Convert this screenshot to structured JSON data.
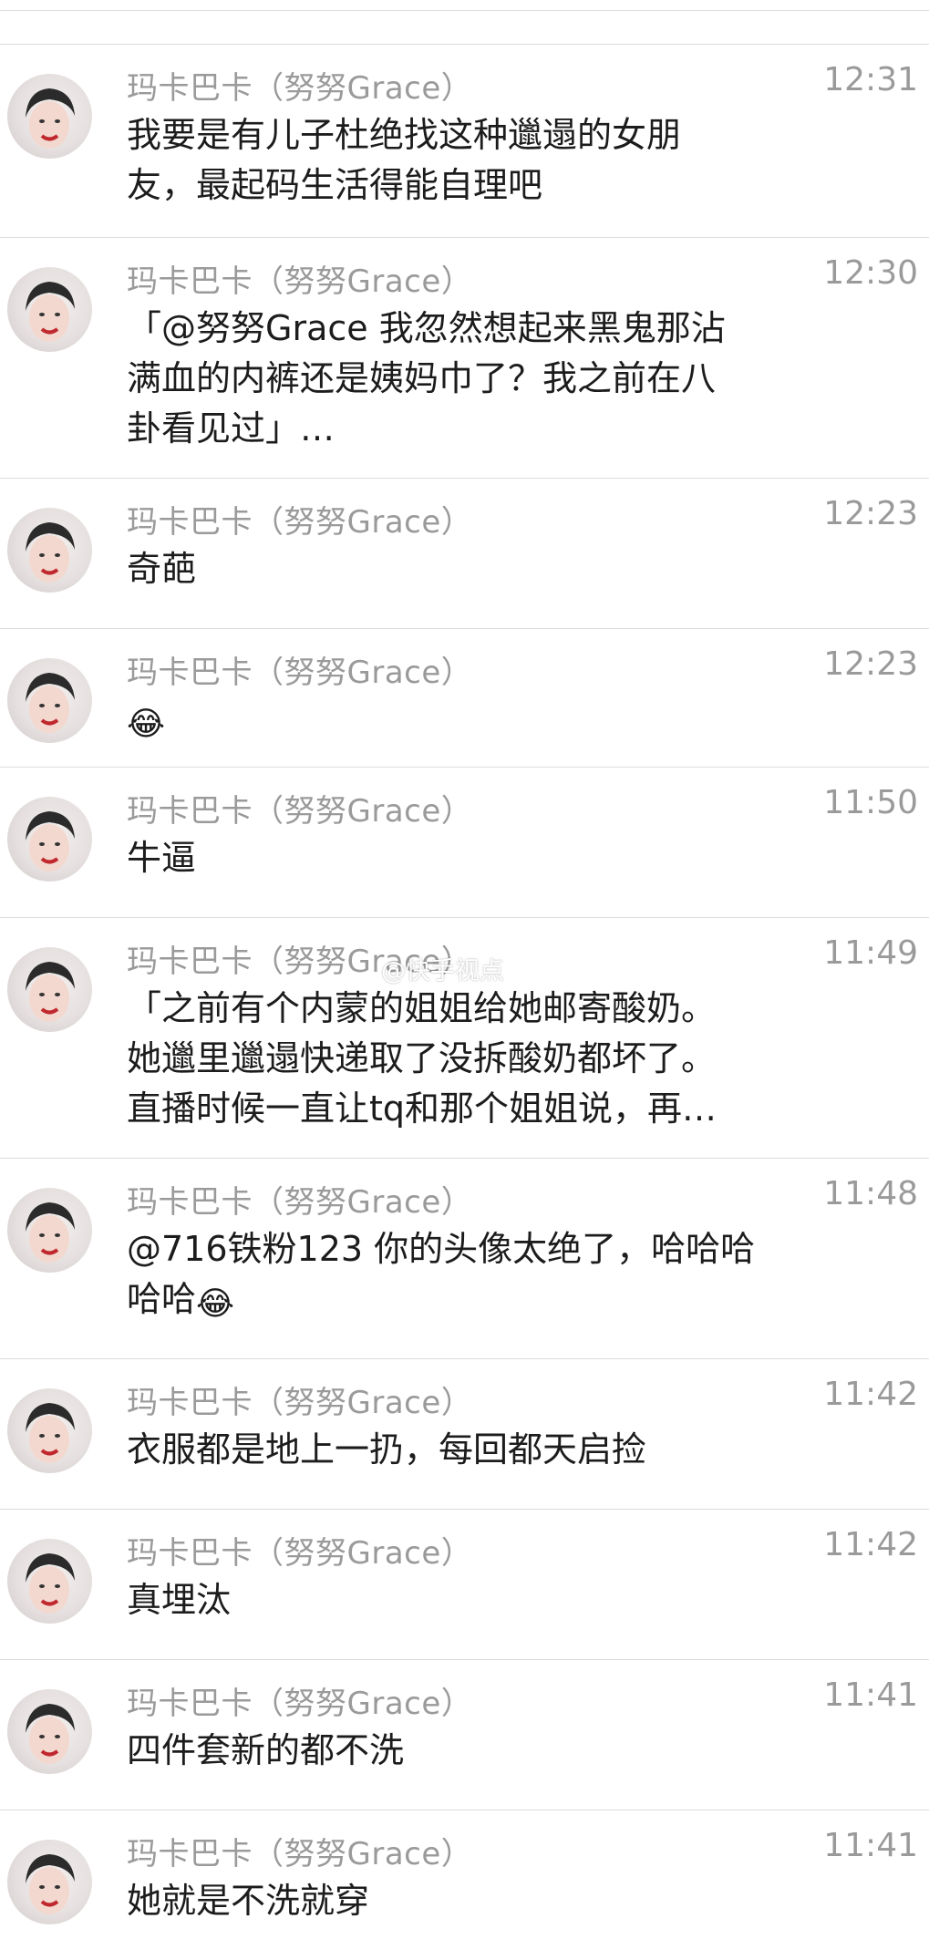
{
  "messages": [
    {
      "sender": "玛卡巴卡（努努Grace）",
      "time": "12:31",
      "text": "我要是有儿子杜绝找这种邋遢的女朋\n友，最起码生活得能自理吧"
    },
    {
      "sender": "玛卡巴卡（努努Grace）",
      "time": "12:30",
      "text": "「@努努Grace 我忽然想起来黑鬼那沾\n满血的内裤还是姨妈巾了？我之前在八\n卦看见过」…"
    },
    {
      "sender": "玛卡巴卡（努努Grace）",
      "time": "12:23",
      "text": "奇葩"
    },
    {
      "sender": "玛卡巴卡（努努Grace）",
      "time": "12:23",
      "text": "",
      "emoji": "😂"
    },
    {
      "sender": "玛卡巴卡（努努Grace）",
      "time": "11:50",
      "text": "牛逼"
    },
    {
      "sender": "玛卡巴卡（努努Grace）",
      "time": "11:49",
      "text": "「之前有个内蒙的姐姐给她邮寄酸奶。\n她邋里邋遢快递取了没拆酸奶都坏了。\n直播时候一直让tq和那个姐姐说，再…"
    },
    {
      "sender": "玛卡巴卡（努努Grace）",
      "time": "11:48",
      "text": "@716铁粉123 你的头像太绝了，哈哈哈\n哈哈",
      "emoji": "😂"
    },
    {
      "sender": "玛卡巴卡（努努Grace）",
      "time": "11:42",
      "text": "衣服都是地上一扔，每回都天启捡"
    },
    {
      "sender": "玛卡巴卡（努努Grace）",
      "time": "11:42",
      "text": "真埋汰"
    },
    {
      "sender": "玛卡巴卡（努努Grace）",
      "time": "11:41",
      "text": "四件套新的都不洗"
    },
    {
      "sender": "玛卡巴卡（努努Grace）",
      "time": "11:41",
      "text": "她就是不洗就穿"
    }
  ],
  "watermark": "@快手视点",
  "icons": {
    "avatar": "avatar-photo",
    "emoji": "tears-of-joy-emoji"
  },
  "colors": {
    "name": "#9a9a9a",
    "time": "#9a9a9a",
    "text": "#1c1c1c",
    "divider": "#dcdcdc"
  }
}
